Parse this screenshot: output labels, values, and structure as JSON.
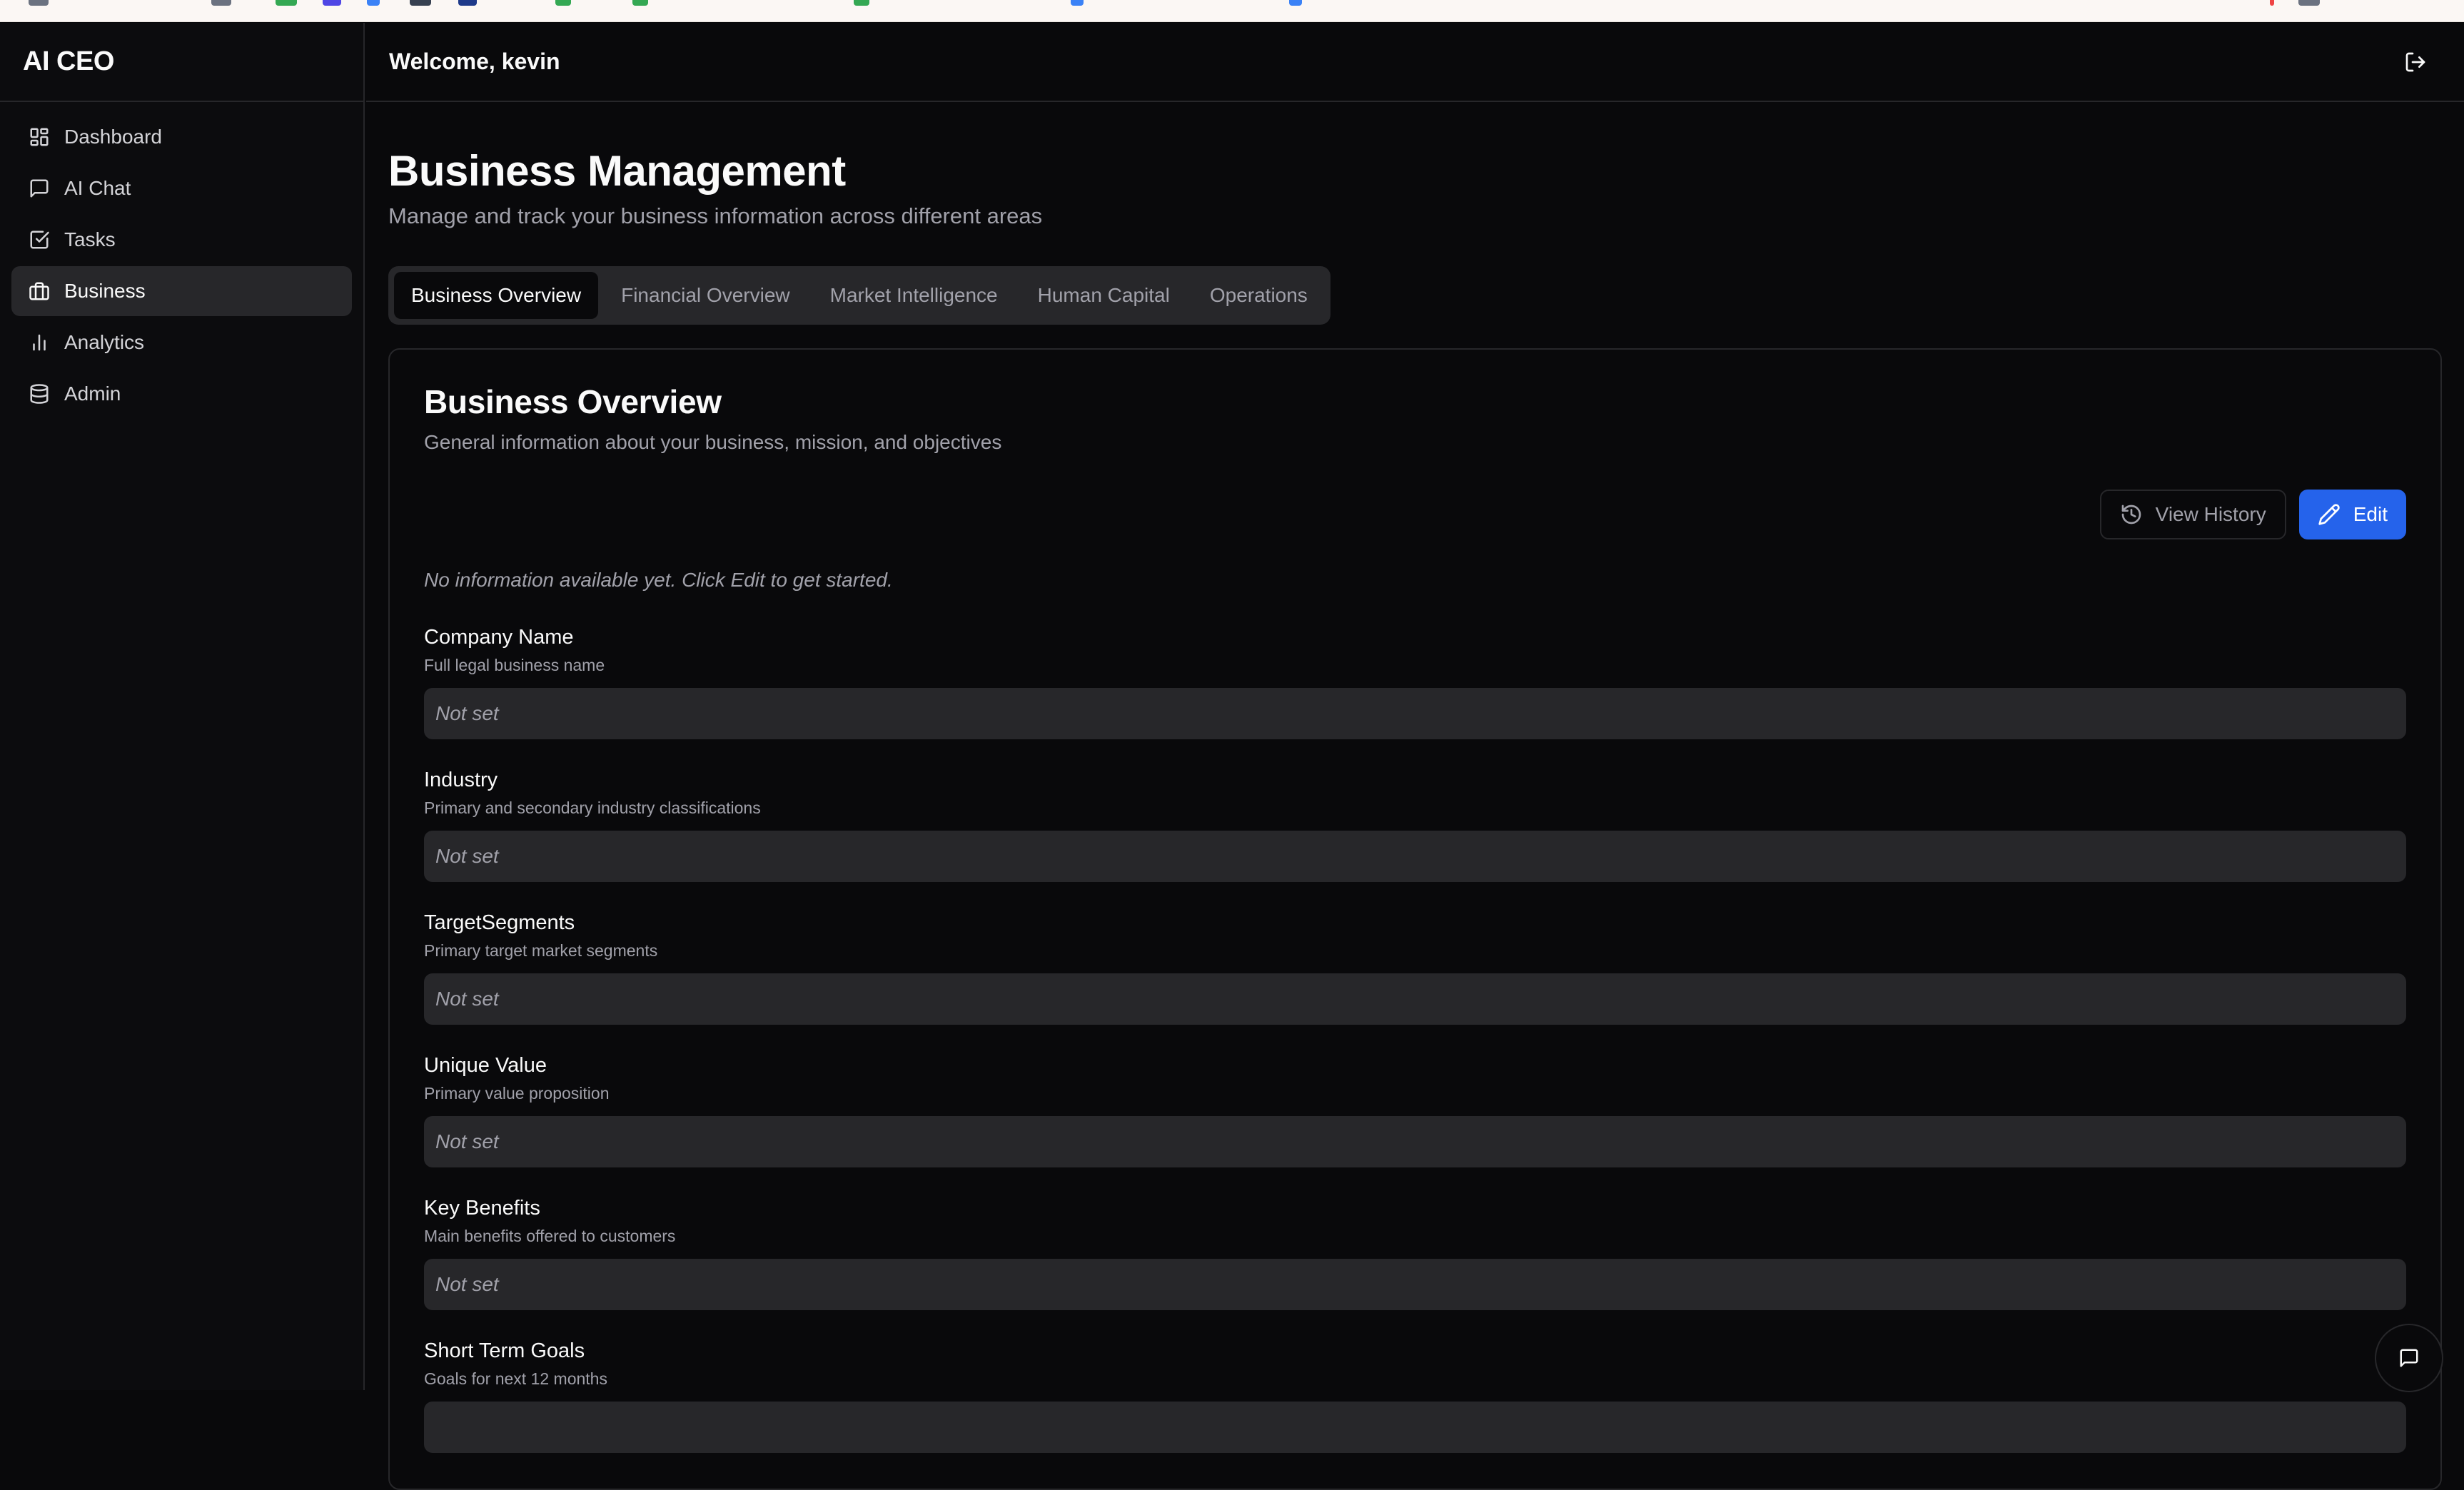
{
  "app": {
    "title": "AI CEO"
  },
  "header": {
    "welcome": "Welcome, kevin",
    "logout_icon": "logout-icon"
  },
  "sidebar": {
    "items": [
      {
        "label": "Dashboard",
        "icon": "dashboard-icon",
        "active": false
      },
      {
        "label": "AI Chat",
        "icon": "chat-icon",
        "active": false
      },
      {
        "label": "Tasks",
        "icon": "checkbox-icon",
        "active": false
      },
      {
        "label": "Business",
        "icon": "briefcase-icon",
        "active": true
      },
      {
        "label": "Analytics",
        "icon": "bar-chart-icon",
        "active": false
      },
      {
        "label": "Admin",
        "icon": "database-icon",
        "active": false
      }
    ]
  },
  "main": {
    "title": "Business Management",
    "subtitle": "Manage and track your business information across different areas",
    "tabs": [
      {
        "label": "Business Overview",
        "active": true
      },
      {
        "label": "Financial Overview",
        "active": false
      },
      {
        "label": "Market Intelligence",
        "active": false
      },
      {
        "label": "Human Capital",
        "active": false
      },
      {
        "label": "Operations",
        "active": false
      }
    ]
  },
  "card": {
    "title": "Business Overview",
    "subtitle": "General information about your business, mission, and objectives",
    "view_history_label": "View History",
    "edit_label": "Edit",
    "empty_note": "No information available yet. Click Edit to get started.",
    "fields": [
      {
        "label": "Company Name",
        "help": "Full legal business name",
        "value": "Not set"
      },
      {
        "label": "Industry",
        "help": "Primary and secondary industry classifications",
        "value": "Not set"
      },
      {
        "label": "TargetSegments",
        "help": "Primary target market segments",
        "value": "Not set"
      },
      {
        "label": "Unique Value",
        "help": "Primary value proposition",
        "value": "Not set"
      },
      {
        "label": "Key Benefits",
        "help": "Main benefits offered to customers",
        "value": "Not set"
      },
      {
        "label": "Short Term Goals",
        "help": "Goals for next 12 months",
        "value": ""
      }
    ]
  },
  "colors": {
    "background": "#09090b",
    "sidebar_bg": "#0c0c0e",
    "border": "#27272a",
    "muted_text": "#a1a1aa",
    "accent": "#2563eb"
  }
}
